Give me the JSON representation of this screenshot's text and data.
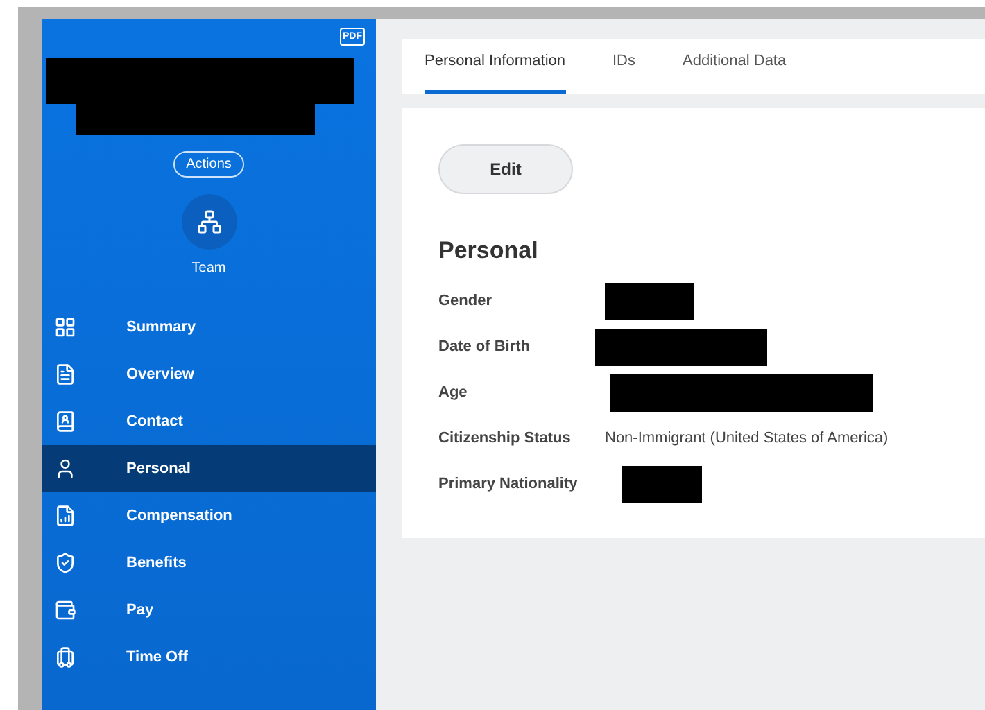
{
  "sidebar": {
    "pdf_label": "PDF",
    "name_redacted": true,
    "actions_label": "Actions",
    "team_label": "Team",
    "items": [
      {
        "label": "Summary",
        "kind": "grid",
        "selected": false
      },
      {
        "label": "Overview",
        "kind": "doc",
        "selected": false
      },
      {
        "label": "Contact",
        "kind": "contact",
        "selected": false
      },
      {
        "label": "Personal",
        "kind": "person",
        "selected": true
      },
      {
        "label": "Compensation",
        "kind": "chart",
        "selected": false
      },
      {
        "label": "Benefits",
        "kind": "shield",
        "selected": false
      },
      {
        "label": "Pay",
        "kind": "wallet",
        "selected": false
      },
      {
        "label": "Time Off",
        "kind": "luggage",
        "selected": false
      }
    ]
  },
  "tabs": [
    {
      "label": "Personal Information",
      "selected": true
    },
    {
      "label": "IDs",
      "selected": false
    },
    {
      "label": "Additional Data",
      "selected": false
    }
  ],
  "card": {
    "edit_button": "Edit",
    "heading": "Personal",
    "fields": [
      {
        "label": "Gender",
        "value": {
          "kind": "redacted"
        }
      },
      {
        "label": "Date of Birth",
        "value": {
          "kind": "redacted"
        }
      },
      {
        "label": "Age",
        "value": {
          "kind": "redacted"
        }
      },
      {
        "label": "Citizenship Status",
        "value": {
          "kind": "text",
          "text": "Non-Immigrant (United States of America)"
        }
      },
      {
        "label": "Primary Nationality",
        "value": {
          "kind": "redacted"
        }
      }
    ]
  }
}
